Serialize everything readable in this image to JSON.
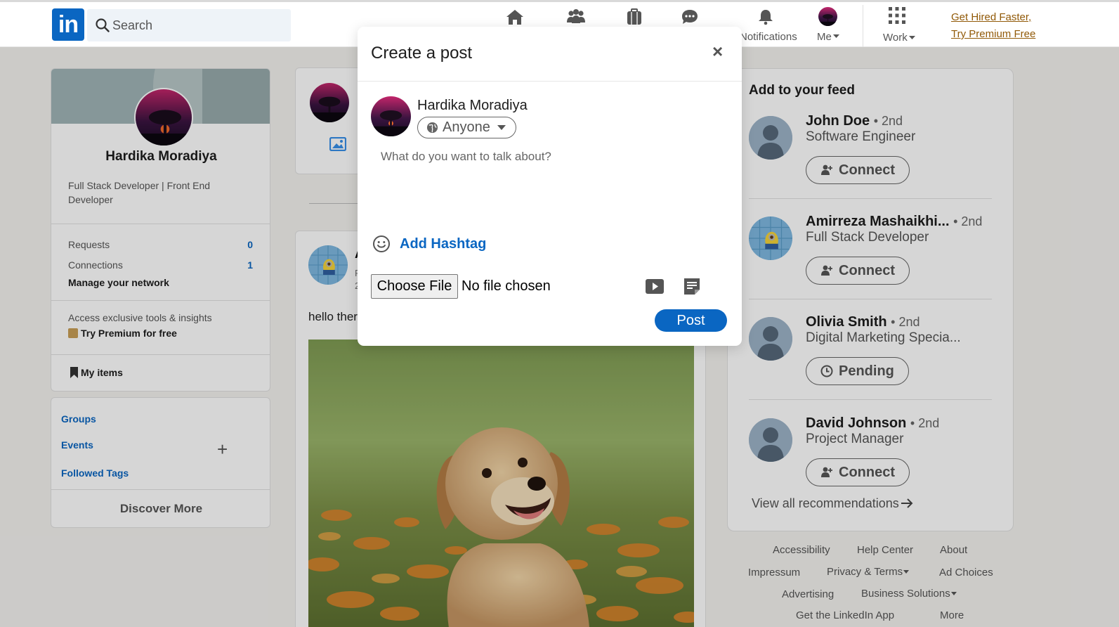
{
  "header": {
    "logo_text": "in",
    "search_placeholder": "Search",
    "nav": [
      {
        "icon": "home-icon",
        "label": ""
      },
      {
        "icon": "my-network-icon",
        "label": ""
      },
      {
        "icon": "jobs-icon",
        "label": ""
      },
      {
        "icon": "messaging-icon",
        "label": ""
      },
      {
        "icon": "bell-icon",
        "label": "Notifications"
      },
      {
        "icon": "avatar-icon",
        "label": "Me"
      },
      {
        "icon": "grid-icon",
        "label": "Work"
      }
    ],
    "premium_line1": "Get Hired Faster,",
    "premium_line2": "Try Premium Free"
  },
  "profile": {
    "name": "Hardika Moradiya",
    "headline": "Full Stack Developer | Front End Developer",
    "requests_label": "Requests",
    "requests_value": "0",
    "connections_label": "Connections",
    "connections_value": "1",
    "manage_network": "Manage your network",
    "premium_pitch": "Access exclusive tools & insights",
    "try_premium": "Try Premium for free",
    "my_items": "My items"
  },
  "links": {
    "groups": "Groups",
    "events": "Events",
    "followed_tags": "Followed Tags",
    "plus": "+",
    "discover_more": "Discover More"
  },
  "feed_post": {
    "author_initial": "A",
    "meta_line1": "F",
    "meta_line2": "2",
    "text": "hello ther"
  },
  "right_feed": {
    "title": "Add to your feed",
    "recommendations": [
      {
        "name": "John Doe",
        "degree": "• 2nd",
        "role": "Software Engineer",
        "action": "Connect"
      },
      {
        "name": "Amirreza Mashaikhi...",
        "degree": "• 2nd",
        "role": "Full Stack Developer",
        "action": "Connect"
      },
      {
        "name": "Olivia Smith",
        "degree": "• 2nd",
        "role": "Digital Marketing Specia...",
        "action": "Pending"
      },
      {
        "name": "David Johnson",
        "degree": "• 2nd",
        "role": "Project Manager",
        "action": "Connect"
      }
    ],
    "view_all": "View all recommendations"
  },
  "footer": {
    "accessibility": "Accessibility",
    "help_center": "Help Center",
    "about": "About",
    "impressum": "Impressum",
    "privacy_terms": "Privacy & Terms",
    "ad_choices": "Ad Choices",
    "advertising": "Advertising",
    "business_solutions": "Business Solutions",
    "get_app": "Get the LinkedIn App",
    "more": "More"
  },
  "modal": {
    "title": "Create a post",
    "close": "×",
    "author_name": "Hardika Moradiya",
    "audience": "Anyone",
    "placeholder": "What do you want to talk about?",
    "add_hashtag": "Add Hashtag",
    "choose_file": "Choose File",
    "file_status": "No file chosen",
    "post_button": "Post"
  },
  "colors": {
    "brand": "#0a66c2",
    "premium_link": "#915907",
    "page_bg": "#f3f2ef"
  }
}
